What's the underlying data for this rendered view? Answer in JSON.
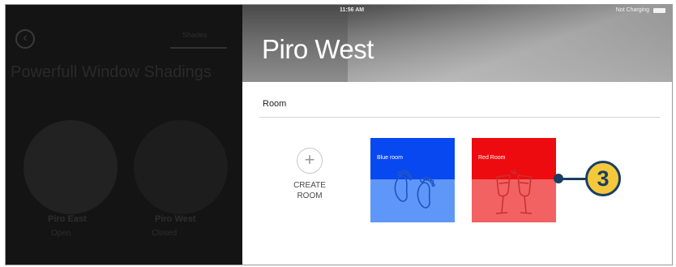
{
  "left_panel": {
    "back_icon": "back-arrow-icon",
    "top_tab": "Shades",
    "heading": "Powerfull Window Shadings",
    "devices": [
      {
        "name": "Piro East",
        "status": "Open"
      },
      {
        "name": "Piro West",
        "status": "Closed"
      }
    ]
  },
  "header": {
    "time": "11:56 AM",
    "charging": "Not Charging",
    "battery_icon": "battery-icon",
    "title": "Piro West"
  },
  "section": {
    "label": "Room"
  },
  "create_room": {
    "icon": "plus-icon",
    "label": "CREATE\nROOM"
  },
  "rooms": [
    {
      "name": "Blue room",
      "icon": "footprints-icon",
      "top_color": "#0848f0",
      "bottom_color": "#5e97f7"
    },
    {
      "name": "Red Room",
      "icon": "wine-glasses-icon",
      "top_color": "#ee0b10",
      "bottom_color": "#f26262"
    }
  ],
  "callout": {
    "number": "3",
    "color": "#1a3e64",
    "fill": "#f4c83a"
  }
}
